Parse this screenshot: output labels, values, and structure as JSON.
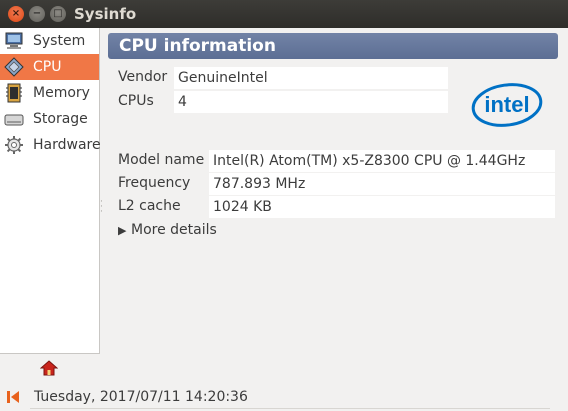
{
  "window": {
    "title": "Sysinfo",
    "buttons": {
      "close": "×",
      "minimize": "−",
      "maximize": "□"
    }
  },
  "sidebar": {
    "items": [
      {
        "label": "System",
        "icon": "computer-icon",
        "active": false
      },
      {
        "label": "CPU",
        "icon": "cpu-chip-icon",
        "active": true
      },
      {
        "label": "Memory",
        "icon": "memory-icon",
        "active": false
      },
      {
        "label": "Storage",
        "icon": "hard-disk-icon",
        "active": false
      },
      {
        "label": "Hardware",
        "icon": "gear-icon",
        "active": false
      }
    ]
  },
  "header": {
    "title": "CPU information"
  },
  "cpu": {
    "vendor_label": "Vendor",
    "vendor_value": "GenuineIntel",
    "cpus_label": "CPUs",
    "cpus_value": "4",
    "model_label": "Model name",
    "model_value": "Intel(R) Atom(TM) x5-Z8300  CPU @ 1.44GHz",
    "frequency_label": "Frequency",
    "frequency_value": "787.893 MHz",
    "l2_label": "L2 cache",
    "l2_value": "1024 KB",
    "more_details": "More details",
    "logo_text": "intel"
  },
  "status": {
    "datetime": "Tuesday, 2017/07/11 14:20:36"
  },
  "colors": {
    "accent": "#f07746",
    "header": "#5c6e94",
    "titlebar": "#3c3b37",
    "intel_blue": "#0071c5"
  }
}
